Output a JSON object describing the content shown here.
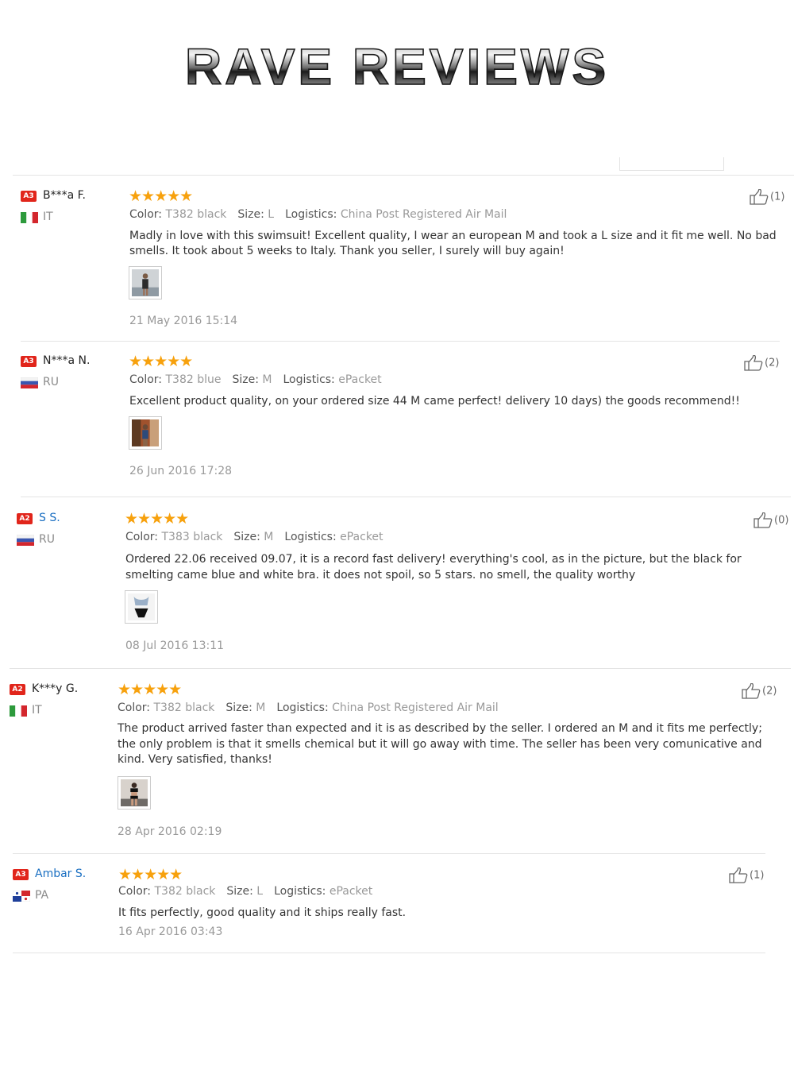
{
  "banner": {
    "title": "RAVE REVIEWS"
  },
  "reviews": [
    {
      "badge": "A3",
      "name": "B***a F.",
      "country": "IT",
      "stars": "★★★★★",
      "helpful": "(1)",
      "color_label": "Color:",
      "color": "T382 black",
      "size_label": "Size:",
      "size": "L",
      "logistics_label": "Logistics:",
      "logistics": "China Post Registered Air Mail",
      "text": "Madly in love with this swimsuit! Excellent quality, I wear an european M and took a L size and it fit me well. No bad smells. It took about 5 weeks to Italy. Thank you seller, I surely will buy again!",
      "date": "21 May 2016 15:14"
    },
    {
      "badge": "A3",
      "name": "N***a N.",
      "country": "RU",
      "stars": "★★★★★",
      "helpful": "(2)",
      "color_label": "Color:",
      "color": "T382 blue",
      "size_label": "Size:",
      "size": "M",
      "logistics_label": "Logistics:",
      "logistics": "ePacket",
      "text": "Excellent product quality, on your ordered size 44 M came perfect! delivery 10 days) the goods recommend!!",
      "date": "26 Jun 2016 17:28"
    },
    {
      "badge": "A2",
      "name": "S S.",
      "country": "RU",
      "stars": "★★★★★",
      "helpful": "(0)",
      "color_label": "Color:",
      "color": "T383 black",
      "size_label": "Size:",
      "size": "M",
      "logistics_label": "Logistics:",
      "logistics": "ePacket",
      "text": "Ordered 22.06 received 09.07, it is a record fast delivery! everything's cool, as in the picture, but the black for smelting came blue and white bra. it does not spoil, so 5 stars. no smell, the quality worthy",
      "date": "08 Jul 2016 13:11"
    },
    {
      "badge": "A2",
      "name": "K***y G.",
      "country": "IT",
      "stars": "★★★★★",
      "helpful": "(2)",
      "color_label": "Color:",
      "color": "T382 black",
      "size_label": "Size:",
      "size": "M",
      "logistics_label": "Logistics:",
      "logistics": "China Post Registered Air Mail",
      "text": "The product arrived faster than expected and it is as described by the seller. I ordered an M and it fits me perfectly; the only problem is that it smells chemical but it will go away with time. The seller has been very comunicative and kind. Very satisfied, thanks!",
      "date": "28 Apr 2016 02:19"
    },
    {
      "badge": "A3",
      "name": "Ambar S.",
      "country": "PA",
      "stars": "★★★★★",
      "helpful": "(1)",
      "color_label": "Color:",
      "color": "T382 black",
      "size_label": "Size:",
      "size": "L",
      "logistics_label": "Logistics:",
      "logistics": "ePacket",
      "text": "It fits perfectly, good quality and it ships really fast.",
      "date": "16 Apr 2016 03:43"
    }
  ],
  "colors": {
    "badge": "#e1251b",
    "stars": "#f7a10d",
    "link_name": "#1a6fc2"
  }
}
